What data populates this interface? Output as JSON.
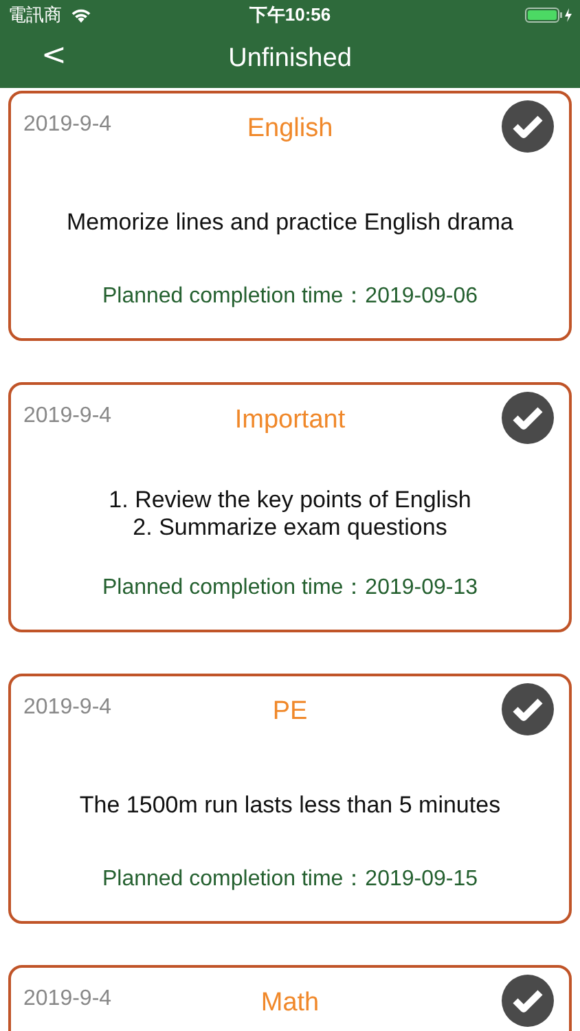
{
  "status_bar": {
    "carrier": "電訊商",
    "time": "下午10:56"
  },
  "nav": {
    "back": "<",
    "title": "Unfinished"
  },
  "tasks": [
    {
      "date": "2019-9-4",
      "title": "English",
      "lines": [
        "Memorize lines and practice English drama"
      ],
      "planned": "Planned completion time：2019-09-06"
    },
    {
      "date": "2019-9-4",
      "title": "Important",
      "lines": [
        "1. Review the key points of English",
        "2. Summarize exam questions"
      ],
      "planned": "Planned completion time：2019-09-13"
    },
    {
      "date": "2019-9-4",
      "title": "PE",
      "lines": [
        "The 1500m run lasts less than 5 minutes"
      ],
      "planned": "Planned completion time：2019-09-15"
    },
    {
      "date": "2019-9-4",
      "title": "Math"
    }
  ]
}
